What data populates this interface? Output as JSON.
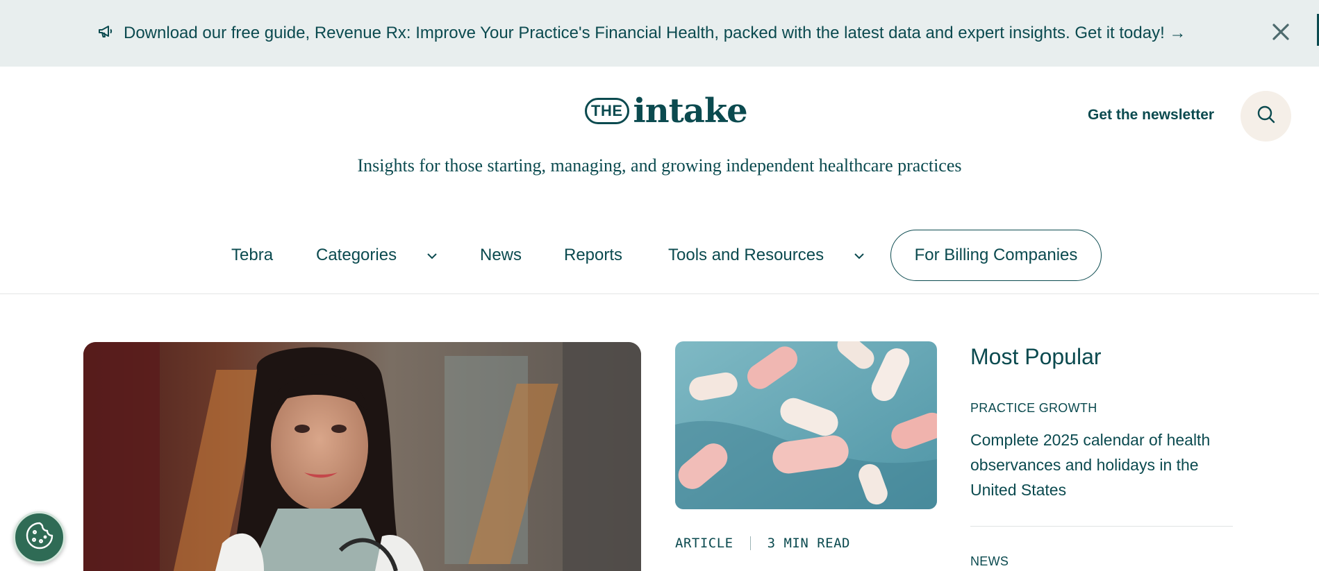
{
  "banner": {
    "text": "Download our free guide, Revenue Rx: Improve Your Practice's Financial Health, packed with the latest data and expert insights. Get it today! →",
    "icon": "megaphone-icon",
    "close_icon": "close-icon"
  },
  "header": {
    "logo_prefix": "THE",
    "logo_word": "intake",
    "tagline": "Insights for those starting, managing, and growing independent healthcare practices",
    "newsletter_label": "Get the newsletter",
    "search_icon": "search-icon"
  },
  "nav": {
    "items": [
      {
        "label": "Tebra"
      },
      {
        "label": "Categories",
        "has_dropdown": true
      },
      {
        "label": "News"
      },
      {
        "label": "Reports"
      },
      {
        "label": "Tools and Resources",
        "has_dropdown": true
      }
    ],
    "cta_label": "For Billing Companies"
  },
  "featured": {
    "meta_type": "ARTICLE",
    "meta_read": "3 MIN READ"
  },
  "most_popular": {
    "title": "Most Popular",
    "items": [
      {
        "category": "PRACTICE GROWTH",
        "headline": "Complete 2025 calendar of health observances and holidays in the United States"
      },
      {
        "category": "NEWS",
        "headline": ""
      }
    ]
  },
  "cookie": {
    "icon": "cookie-icon"
  },
  "colors": {
    "brand": "#0b4a4f",
    "banner_bg": "#e8eeee",
    "search_bg": "#f5efe8",
    "cookie_bg": "#2f6b55"
  }
}
